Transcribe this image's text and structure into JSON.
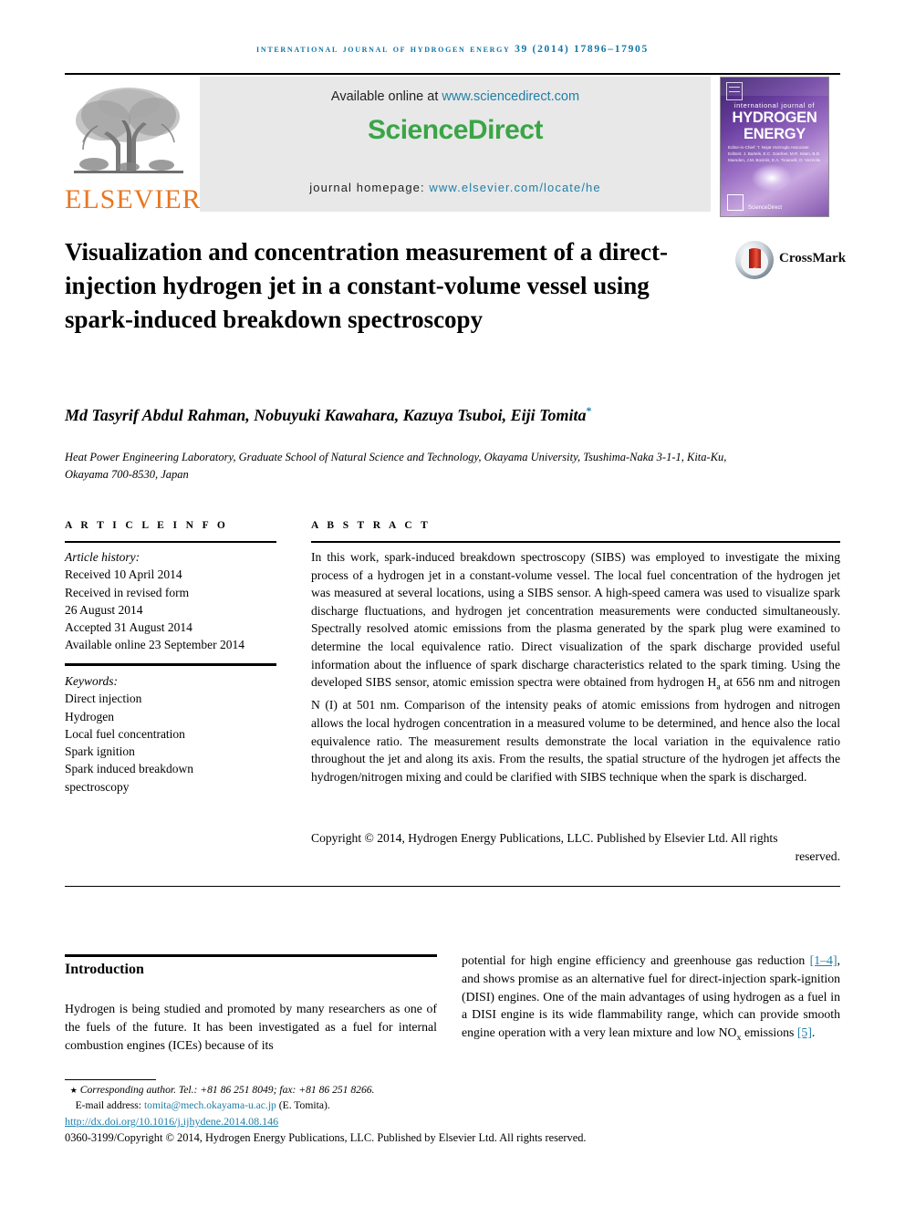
{
  "running_head": "International Journal of Hydrogen Energy 39 (2014) 17896–17905",
  "masthead": {
    "publisher_logo_word": "ELSEVIER",
    "publisher_logo_icon": "elsevier-tree-icon",
    "available_prefix": "Available online at ",
    "available_link": "www.sciencedirect.com",
    "sciencedirect_wordmark": "ScienceDirect",
    "homepage_prefix": "journal homepage: ",
    "homepage_link": "www.elsevier.com/locate/he",
    "cover": {
      "line1": "international journal of",
      "line2": "HYDROGEN",
      "line3": "ENERGY",
      "editors": "Editor-in-Chief:  T. Nejat Veziroglu\nAssociate Editors:  J. Bartels, E.C. Gardner, M.R. Islam,\nB.D. Marsden, J.M. Bockris,\nE.A. Ticianelli, D. Vezirollu",
      "footer_label": "ScienceDirect",
      "icon": "journal-cover-thumbnail"
    },
    "crossmark": {
      "label": "CrossMark",
      "icon": "crossmark-logo-icon"
    }
  },
  "article": {
    "title": "Visualization and concentration measurement of a direct-injection hydrogen jet in a constant-volume vessel using spark-induced breakdown spectroscopy",
    "authors": "Md Tasyrif Abdul Rahman, Nobuyuki Kawahara, Kazuya Tsuboi, Eiji Tomita",
    "corresponding_marker": "*",
    "affiliation": "Heat Power Engineering Laboratory, Graduate School of Natural Science and Technology, Okayama University, Tsushima-Naka 3-1-1, Kita-Ku, Okayama 700-8530, Japan"
  },
  "article_info": {
    "heading": "A R T I C L E  I N F O",
    "history_label": "Article history:",
    "history": [
      "Received 10 April 2014",
      "Received in revised form",
      "26 August 2014",
      "Accepted 31 August 2014",
      "Available online 23 September 2014"
    ],
    "keywords_label": "Keywords:",
    "keywords": [
      "Direct injection",
      "Hydrogen",
      "Local fuel concentration",
      "Spark ignition",
      "Spark induced breakdown",
      "spectroscopy"
    ]
  },
  "abstract": {
    "heading": "A B S T R A C T",
    "part1": "In this work, spark-induced breakdown spectroscopy (SIBS) was employed to investigate the mixing process of a hydrogen jet in a constant-volume vessel. The local fuel concentration of the hydrogen jet was measured at several locations, using a SIBS sensor. A high-speed camera was used to visualize spark discharge fluctuations, and hydrogen jet concentration measurements were conducted simultaneously. Spectrally resolved atomic emissions from the plasma generated by the spark plug were examined to determine the local equivalence ratio. Direct visualization of the spark discharge provided useful information about the influence of spark discharge characteristics related to the spark timing. Using the developed SIBS sensor, atomic emission spectra were obtained from hydrogen H",
    "sub1": "a",
    "part2": " at 656 nm and nitrogen N (I) at 501 nm. Comparison of the intensity peaks of atomic emissions from hydrogen and nitrogen allows the local hydrogen concentration in a measured volume to be determined, and hence also the local equivalence ratio. The measurement results demonstrate the local variation in the equivalence ratio throughout the jet and along its axis. From the results, the spatial structure of the hydrogen jet affects the hydrogen/nitrogen mixing and could be clarified with SIBS technique when the spark is discharged.",
    "copyright_main": "Copyright © 2014, Hydrogen Energy Publications, LLC. Published by Elsevier Ltd. All rights",
    "copyright_tail": "reserved."
  },
  "body": {
    "intro_heading": "Introduction",
    "left_text": "Hydrogen is being studied and promoted by many researchers as one of the fuels of the future. It has been investigated as a fuel for internal combustion engines (ICEs) because of its",
    "right_part1": "potential for high engine efficiency and greenhouse gas reduction ",
    "right_cite1": "[1–4]",
    "right_part2": ", and shows promise as an alternative fuel for direct-injection spark-ignition (DISI) engines. One of the main advantages of using hydrogen as a fuel in a DISI engine is its wide flammability range, which can provide smooth engine operation with a very lean mixture and low NO",
    "right_sub": "x",
    "right_part3": " emissions ",
    "right_cite2": "[5]",
    "right_part4": "."
  },
  "footer": {
    "corresponding": "Corresponding author. Tel.: +81 86 251 8049; fax: +81 86 251 8266.",
    "email_label": "E-mail address: ",
    "email": "tomita@mech.okayama-u.ac.jp",
    "email_suffix": " (E. Tomita).",
    "doi": "http://dx.doi.org/10.1016/j.ijhydene.2014.08.146",
    "issn_line": "0360-3199/Copyright © 2014, Hydrogen Energy Publications, LLC. Published by Elsevier Ltd. All rights reserved."
  },
  "colors": {
    "link_blue": "#1f7fa8",
    "sciencedirect_green": "#3aa546",
    "elsevier_orange": "#e87722",
    "header_blue": "#0e76a8"
  }
}
